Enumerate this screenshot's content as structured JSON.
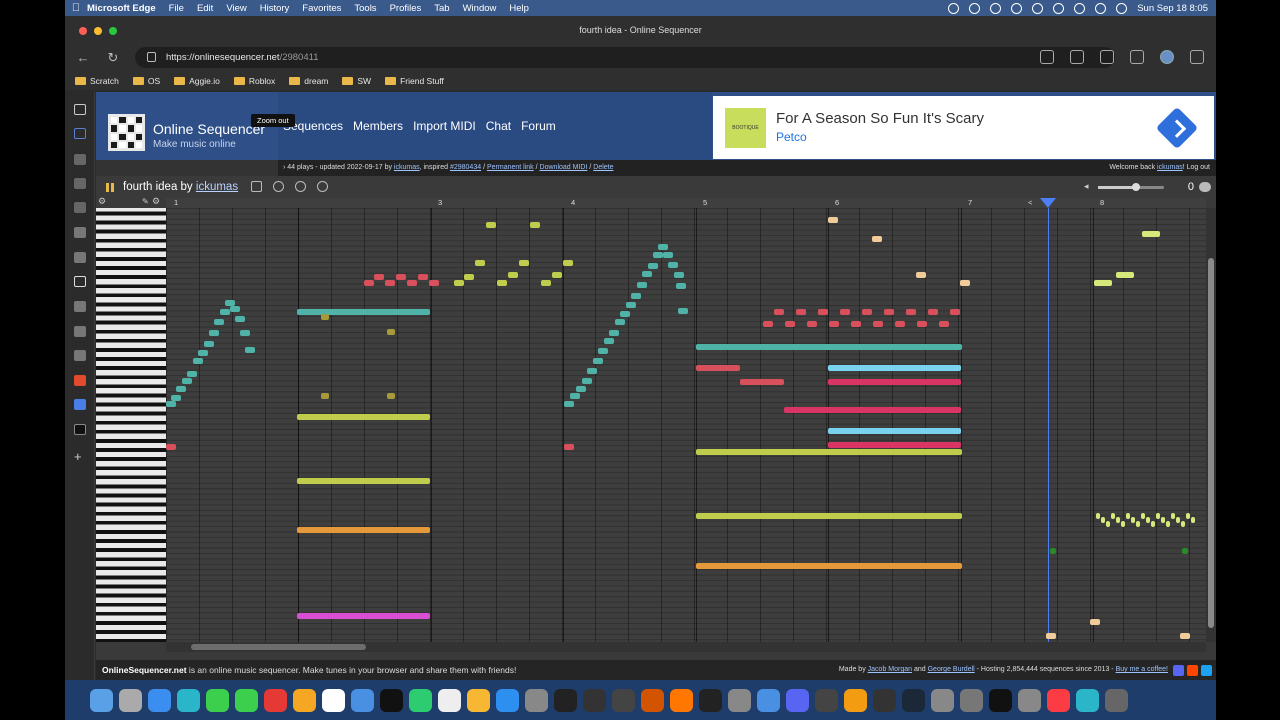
{
  "menubar": {
    "app_name": "Microsoft Edge",
    "items": [
      "File",
      "Edit",
      "View",
      "History",
      "Favorites",
      "Tools",
      "Profiles",
      "Tab",
      "Window",
      "Help"
    ],
    "clock": "Sun Sep 18  8:05"
  },
  "browser": {
    "tab_title": "fourth idea - Online Sequencer",
    "url_host": "https://onlinesequencer.net",
    "url_path": "/2980411",
    "bookmarks": [
      "Scratch",
      "OS",
      "Aggie.io",
      "Roblox",
      "dream",
      "SW",
      "Friend Stuff"
    ]
  },
  "site": {
    "name": "Online Sequencer",
    "tagline": "Make music online",
    "nav": [
      "Sequences",
      "Members",
      "Import MIDI",
      "Chat",
      "Forum"
    ],
    "ad": {
      "title": "For A Season So Fun It's Scary",
      "brand": "Petco",
      "img_text": "BOOTIQUE"
    },
    "info": {
      "prefix": "44 plays - updated 2022-09-17 by",
      "author": "ickumas",
      "inspired_label": ", inspired",
      "inspired_link": "#2980434",
      "permalink": "Permanent link",
      "download": "Download MIDI",
      "delete": "Delete",
      "sep": "/",
      "welcome_prefix": "Welcome back",
      "welcome_user": "ickumas",
      "welcome_suffix": "!",
      "logout": "Log out"
    }
  },
  "toolbar": {
    "title_prefix": "fourth idea by",
    "author": "ickumas",
    "tooltip": "Zoom out",
    "count": "0"
  },
  "ruler": {
    "measures": [
      "1",
      "3",
      "4",
      "5",
      "6",
      "7",
      "8"
    ],
    "marker": "<"
  },
  "footer": {
    "brand": "OnlineSequencer.net",
    "text": " is an online music sequencer. Make tunes in your browser and share them with friends!",
    "made_by": "Made by",
    "person1": "Jacob Morgan",
    "and": "and",
    "person2": "George Burdell",
    "hosting": "- Hosting 2,854,444 sequences since 2013 -",
    "coffee": "Buy me a coffee!"
  },
  "colors": {
    "teal": "#4fb3a8",
    "red": "#d8505c",
    "yellow_green": "#c0cc4c",
    "orange": "#e5993a",
    "magenta": "#d94fd1",
    "light_blue": "#7ad3ee",
    "crimson": "#d93464",
    "peach": "#f1cc99",
    "olive": "#a89a3a",
    "lime": "#d6e87a",
    "accent": "#4c7ef5"
  }
}
